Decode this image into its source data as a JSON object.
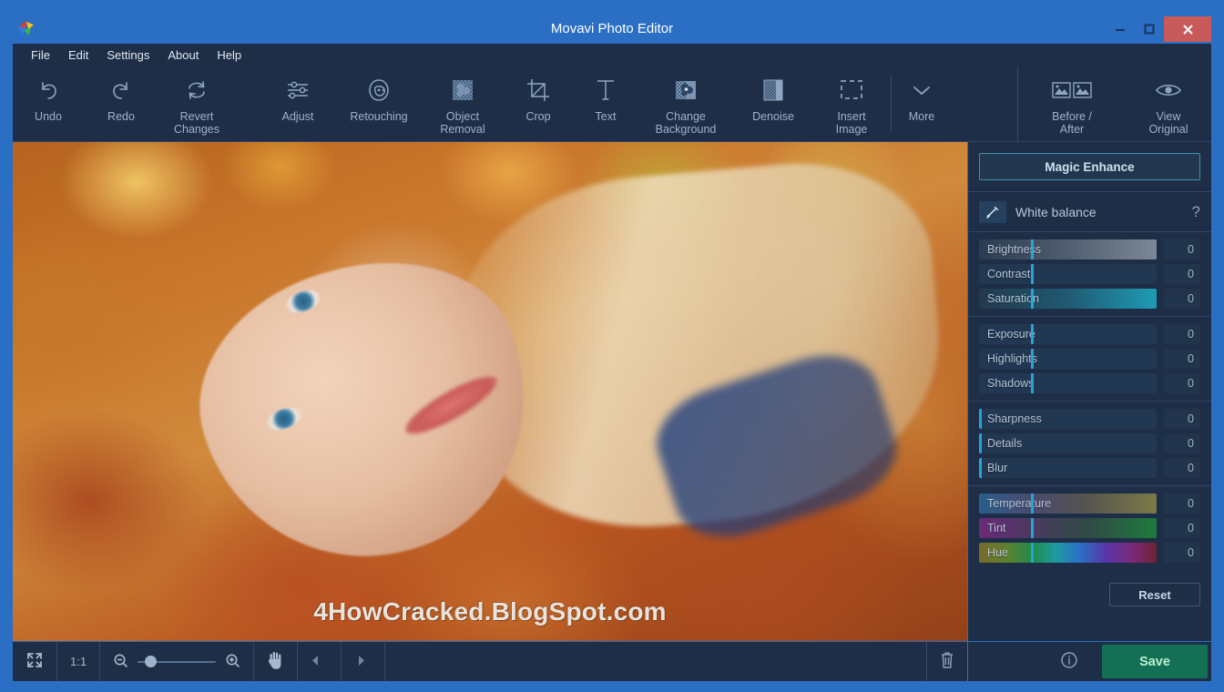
{
  "window": {
    "title": "Movavi Photo Editor",
    "app_icon": "pinwheel-logo",
    "controls": {
      "minimize": "—",
      "maximize": "▭",
      "close": "✕"
    }
  },
  "menu": {
    "items": [
      {
        "label": "File"
      },
      {
        "label": "Edit"
      },
      {
        "label": "Settings"
      },
      {
        "label": "About"
      },
      {
        "label": "Help"
      }
    ]
  },
  "toolbar": {
    "history": [
      {
        "label": "Undo",
        "icon": "undo-arrow-icon"
      },
      {
        "label": "Redo",
        "icon": "redo-arrow-icon"
      },
      {
        "label": "Revert\nChanges",
        "icon": "revert-circular-arrows-icon"
      }
    ],
    "tools": [
      {
        "label": "Adjust",
        "icon": "sliders-icon"
      },
      {
        "label": "Retouching",
        "icon": "face-icon"
      },
      {
        "label": "Object\nRemoval",
        "icon": "object-removal-icon"
      },
      {
        "label": "Crop",
        "icon": "crop-icon"
      },
      {
        "label": "Text",
        "icon": "text-t-icon"
      },
      {
        "label": "Change\nBackground",
        "icon": "change-background-icon"
      },
      {
        "label": "Denoise",
        "icon": "denoise-icon"
      },
      {
        "label": "Insert\nImage",
        "icon": "insert-image-dashed-icon"
      },
      {
        "label": "More",
        "icon": "chevron-down-icon"
      }
    ],
    "view": [
      {
        "label": "Before /\nAfter",
        "icon": "before-after-icon"
      },
      {
        "label": "View\nOriginal",
        "icon": "eye-icon"
      }
    ]
  },
  "panel": {
    "magic_enhance": "Magic Enhance",
    "white_balance": {
      "label": "White balance",
      "picker_icon": "eyedropper-icon",
      "help": "?"
    },
    "reset": "Reset",
    "groups": [
      {
        "name": "tone",
        "sliders": [
          {
            "label": "Brightness",
            "value": "0",
            "handle_pct": 29,
            "gradient": "brightness"
          },
          {
            "label": "Contrast",
            "value": "0",
            "handle_pct": 29,
            "gradient": "plain"
          },
          {
            "label": "Saturation",
            "value": "0",
            "handle_pct": 29,
            "gradient": "saturation"
          }
        ]
      },
      {
        "name": "exposure",
        "sliders": [
          {
            "label": "Exposure",
            "value": "0",
            "handle_pct": 29,
            "gradient": "plain"
          },
          {
            "label": "Highlights",
            "value": "0",
            "handle_pct": 29,
            "gradient": "plain"
          },
          {
            "label": "Shadows",
            "value": "0",
            "handle_pct": 29,
            "gradient": "plain"
          }
        ]
      },
      {
        "name": "detail",
        "sliders": [
          {
            "label": "Sharpness",
            "value": "0",
            "handle_pct": 0,
            "gradient": "plain"
          },
          {
            "label": "Details",
            "value": "0",
            "handle_pct": 0,
            "gradient": "plain"
          },
          {
            "label": "Blur",
            "value": "0",
            "handle_pct": 0,
            "gradient": "plain"
          }
        ]
      },
      {
        "name": "color",
        "sliders": [
          {
            "label": "Temperature",
            "value": "0",
            "handle_pct": 29,
            "gradient": "temperature"
          },
          {
            "label": "Tint",
            "value": "0",
            "handle_pct": 29,
            "gradient": "tint"
          },
          {
            "label": "Hue",
            "value": "0",
            "handle_pct": 29,
            "gradient": "hue"
          }
        ]
      }
    ]
  },
  "bottom_bar": {
    "fit_icon": "fit-to-screen-icon",
    "zoom_ratio": "1:1",
    "zoom_out_icon": "zoom-out-icon",
    "zoom_in_icon": "zoom-in-icon",
    "zoom_knob_pct": 10,
    "hand_icon": "hand-pan-icon",
    "rotate_left_icon": "rotate-left-icon",
    "rotate_right_icon": "rotate-right-icon",
    "delete_icon": "trash-icon",
    "info_icon": "info-icon",
    "save": "Save"
  },
  "canvas": {
    "watermark": "4HowCracked.BlogSpot.com"
  },
  "colors": {
    "window_frame": "#2a6fc4",
    "panel_bg": "#1d2e46",
    "accent_cyan": "#27a3d4",
    "save_green": "#147055",
    "close_red": "#c85a5a",
    "text_muted": "#9fb2cd"
  }
}
